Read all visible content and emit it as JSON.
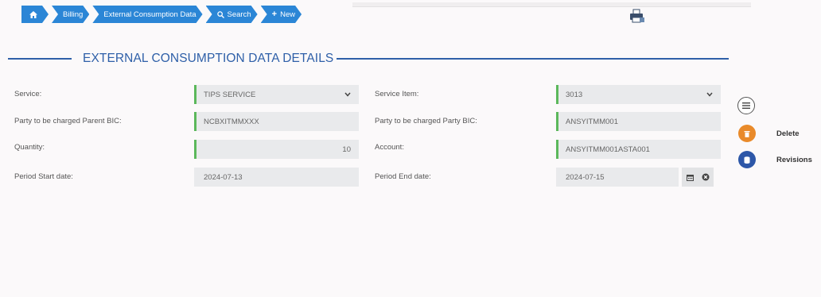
{
  "breadcrumb": {
    "home_icon": "home-icon",
    "items": [
      "Billing",
      "External Consumption Data",
      "Search",
      "New"
    ],
    "search_icon": "search-icon",
    "plus_icon": "plus-icon"
  },
  "section": {
    "title": "EXTERNAL CONSUMPTION DATA DETAILS"
  },
  "form": {
    "service": {
      "label": "Service:",
      "value": "TIPS SERVICE"
    },
    "service_item": {
      "label": "Service Item:",
      "value": "3013"
    },
    "parent_bic": {
      "label": "Party to be charged Parent BIC:",
      "value": "NCBXITMMXXX"
    },
    "party_bic": {
      "label": "Party to be charged Party BIC:",
      "value": "ANSYITMM001"
    },
    "quantity": {
      "label": "Quantity:",
      "value": "10"
    },
    "account": {
      "label": "Account:",
      "value": "ANSYITMM001ASTA001"
    },
    "period_start": {
      "label": "Period Start date:",
      "value": "2024-07-13"
    },
    "period_end": {
      "label": "Period End date:",
      "value": "2024-07-15"
    }
  },
  "actions": {
    "delete_label": "Delete",
    "revisions_label": "Revisions"
  },
  "colors": {
    "accent": "#2b86d6",
    "title": "#2e5fa8",
    "mandatory": "#5bb85b",
    "delete": "#e98a2a",
    "revisions": "#2d57a8"
  }
}
